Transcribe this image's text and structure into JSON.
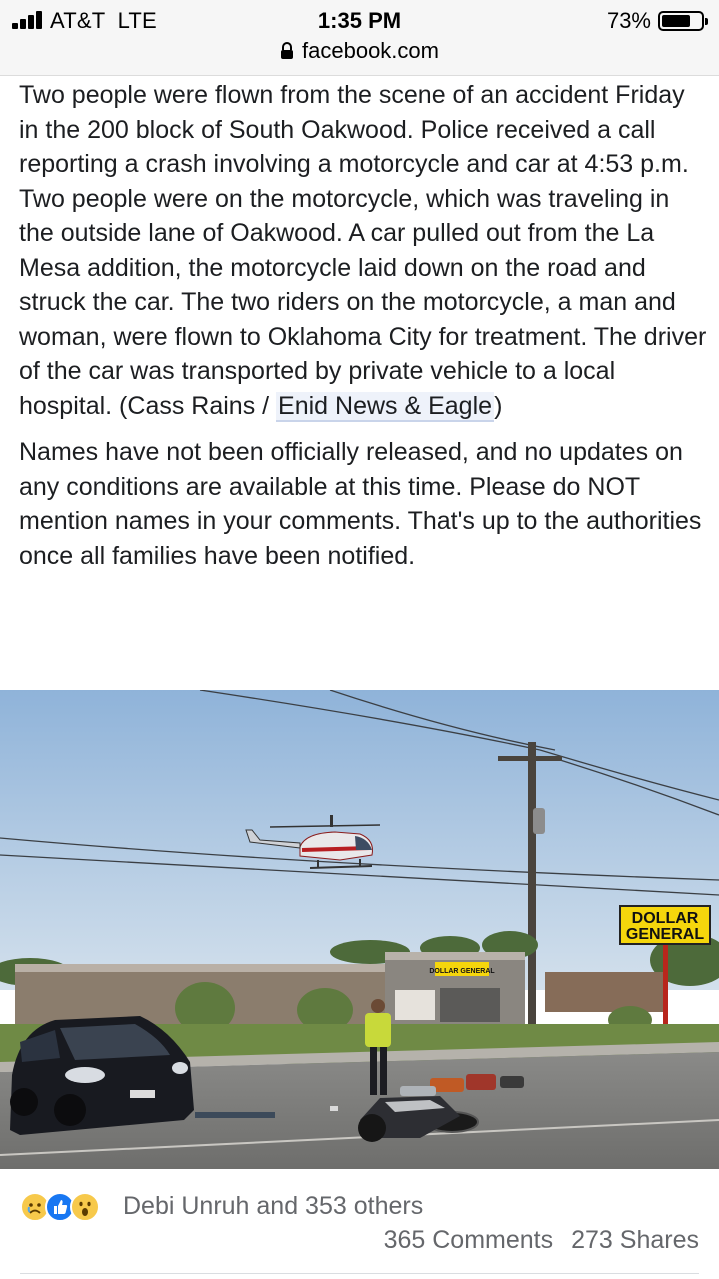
{
  "status_bar": {
    "carrier": "AT&T  LTE",
    "time": "1:35 PM",
    "battery": "73%",
    "battery_level": 0.73
  },
  "browser": {
    "url": "facebook.com"
  },
  "post": {
    "paragraph1_text": "Two people were flown from the scene of an accident Friday in the 200 block of South Oakwood. Police received a call reporting a crash involving a motorcycle and car at 4:53 p.m. Two people were on the motorcycle, which was traveling in the outside lane of Oakwood. A car pulled out from the La Mesa addition, the motorcycle laid down on the road and struck the car. The two riders on the motorcycle, a man and woman, were flown to Oklahoma City for treatment. The driver of the car was transported by private vehicle to a local hospital. (Cass Rains / ",
    "paragraph1_link": "Enid News & Eagle",
    "paragraph1_end": ")",
    "paragraph2": "Names have not been officially released, and no updates on any conditions are available at this time. Please do NOT mention names in your comments. That's up to the authorities once all families have been notified."
  },
  "photo": {
    "store_sign_line1": "DOLLAR",
    "store_sign_line2": "GENERAL",
    "building_sign": "DOLLAR GENERAL"
  },
  "reactions": {
    "icons": [
      "sad-icon",
      "like-icon",
      "wow-icon"
    ],
    "reactors_text": "Debi Unruh and 353 others",
    "comments": "365 Comments",
    "shares": "273 Shares"
  }
}
